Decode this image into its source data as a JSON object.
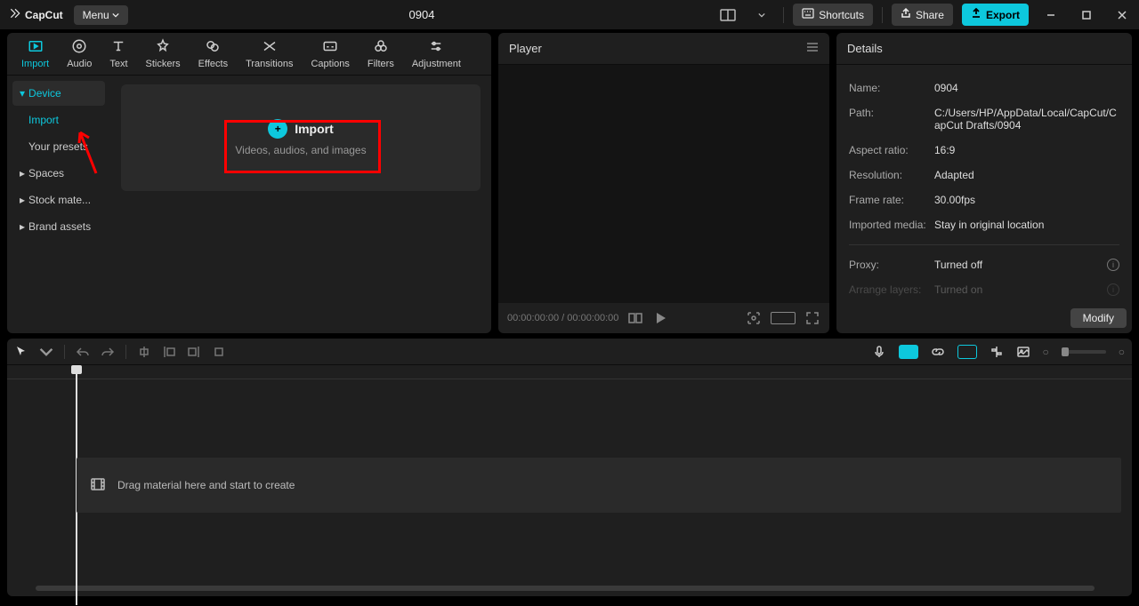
{
  "app": {
    "name": "CapCut",
    "menu": "Menu"
  },
  "project": {
    "title": "0904"
  },
  "titlebar": {
    "shortcuts": "Shortcuts",
    "share": "Share",
    "export": "Export"
  },
  "tabs": [
    {
      "id": "import",
      "label": "Import"
    },
    {
      "id": "audio",
      "label": "Audio"
    },
    {
      "id": "text",
      "label": "Text"
    },
    {
      "id": "stickers",
      "label": "Stickers"
    },
    {
      "id": "effects",
      "label": "Effects"
    },
    {
      "id": "transitions",
      "label": "Transitions"
    },
    {
      "id": "captions",
      "label": "Captions"
    },
    {
      "id": "filters",
      "label": "Filters"
    },
    {
      "id": "adjustment",
      "label": "Adjustment"
    }
  ],
  "sources": {
    "device": "Device",
    "import": "Import",
    "presets": "Your presets",
    "spaces": "Spaces",
    "stock": "Stock mate...",
    "brand": "Brand assets"
  },
  "import_card": {
    "title": "Import",
    "subtitle": "Videos, audios, and images"
  },
  "player": {
    "title": "Player",
    "time_current": "00:00:00:00",
    "time_total": "00:00:00:00"
  },
  "details": {
    "title": "Details",
    "rows": {
      "name_l": "Name:",
      "name_v": "0904",
      "path_l": "Path:",
      "path_v": "C:/Users/HP/AppData/Local/CapCut/CapCut Drafts/0904",
      "aspect_l": "Aspect ratio:",
      "aspect_v": "16:9",
      "res_l": "Resolution:",
      "res_v": "Adapted",
      "fps_l": "Frame rate:",
      "fps_v": "30.00fps",
      "media_l": "Imported media:",
      "media_v": "Stay in original location",
      "proxy_l": "Proxy:",
      "proxy_v": "Turned off",
      "arrange_l": "Arrange layers:",
      "arrange_v": "Turned on"
    },
    "modify": "Modify"
  },
  "timeline": {
    "drop_hint": "Drag material here and start to create"
  }
}
